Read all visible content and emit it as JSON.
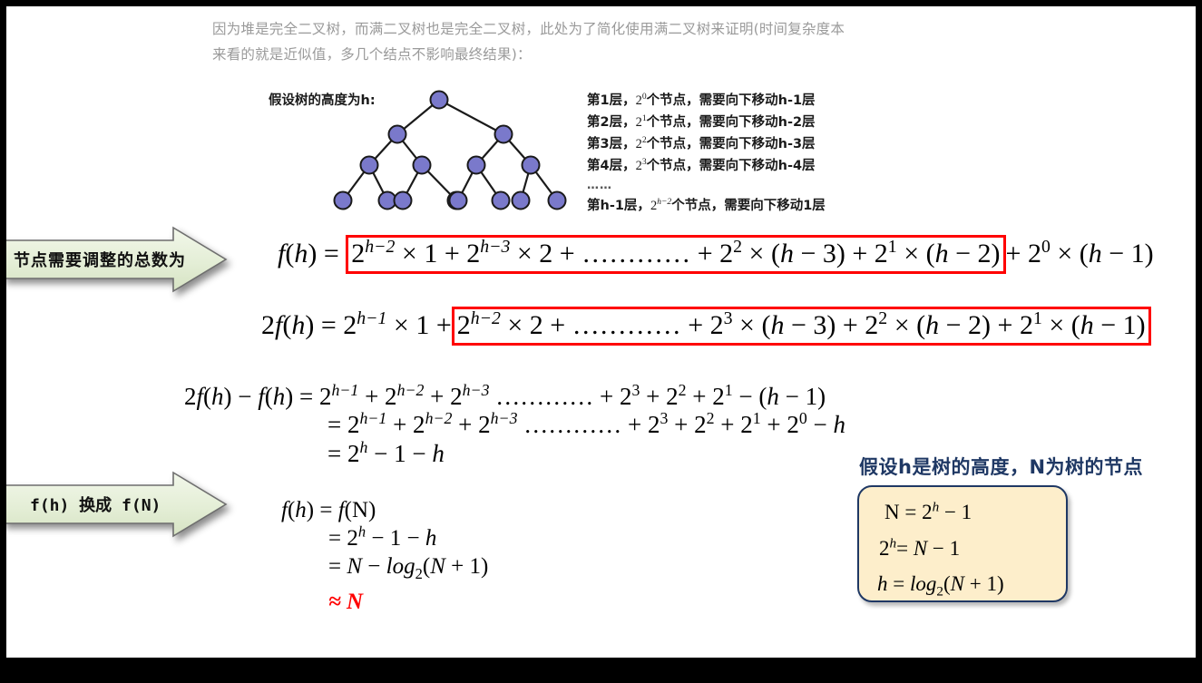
{
  "frame": {
    "border_color": "#000000",
    "page_background": "#ffffff"
  },
  "intro": {
    "line1": "因为堆是完全二叉树，而满二叉树也是完全二叉树，此处为了简化使用满二叉树来证明(时间复杂度本",
    "line2": "来看的就是近似值，多几个结点不影响最终结果)："
  },
  "tree": {
    "caption": "假设树的高度为h:",
    "node_fill": "#7a79cb",
    "node_stroke": "#1a1a1a",
    "edge_color": "#1a1a1a",
    "levels": [
      1,
      2,
      4,
      8
    ]
  },
  "level_list": {
    "rows": [
      {
        "prefix": "第1层，",
        "base": "2",
        "exp": "0",
        "suffix": "个节点，需要向下移动h-1层"
      },
      {
        "prefix": "第2层，",
        "base": "2",
        "exp": "1",
        "suffix": "个节点，需要向下移动h-2层"
      },
      {
        "prefix": "第3层，",
        "base": "2",
        "exp": "2",
        "suffix": "个节点，需要向下移动h-3层"
      },
      {
        "prefix": "第4层，",
        "base": "2",
        "exp": "3",
        "suffix": "个节点，需要向下移动h-4层"
      }
    ],
    "ellipsis": "……",
    "last_row": {
      "prefix": "第h-1层，",
      "base": "2",
      "exp": "h−2",
      "suffix": "个节点，需要向下移动1层"
    }
  },
  "callouts": {
    "total_nodes": {
      "label": "节点需要调整的总数为",
      "fill_start": "#edf3e3",
      "fill_end": "#dbe7cb",
      "stroke": "#7f7f7f"
    },
    "swap_fh_fn": {
      "label": "f(h) 换成 f(N)",
      "fill_start": "#edf3e3",
      "fill_end": "#dbe7cb",
      "stroke": "#7f7f7f"
    }
  },
  "equations": {
    "box_color": "#ff0000",
    "eq1": {
      "lhs": "f(h) =",
      "boxed": "2^{h-2} × 1 + 2^{h-3} × 2 + ………… + 2^2 × (h − 3) + 2^1 × (h − 2)",
      "tail": "+ 2^0 × (h − 1)"
    },
    "eq2": {
      "lhs": "2f(h) = 2^{h-1} × 1 +",
      "boxed": "2^{h-2} × 2 + ………… + 2^3 × (h − 3) + 2^2 × (h − 2) + 2^1 × (h − 1)"
    },
    "eq3": {
      "lhs": "2f(h) − f(h) =",
      "rhs": "2^{h-1} + 2^{h-2} + 2^{h-3} ………… + 2^3 + 2^2 + 2^1 − (h − 1)"
    },
    "eq4": {
      "lhs": "=",
      "rhs": "2^{h-1} + 2^{h-2} + 2^{h-3} ………… + 2^3 + 2^2 + 2^1 + 2^0 − h"
    },
    "eq5": {
      "lhs": "=",
      "rhs": "2^h − 1 − h"
    }
  },
  "fn_block": {
    "line1": "f(h) = f(N)",
    "line2": "= 2^h − 1 − h",
    "line3": "= N − log_2(N + 1)",
    "line4": "≈ N",
    "approx_color": "#ff0000"
  },
  "yellow_callout": {
    "title": "假设h是树的高度，N为树的节点",
    "title_color": "#1f3864",
    "fill": "#fdeecb",
    "border": "#1f3864",
    "line1": "N = 2^h − 1",
    "line2": "2^h = N − 1",
    "line3": "h = log_2(N + 1)"
  }
}
